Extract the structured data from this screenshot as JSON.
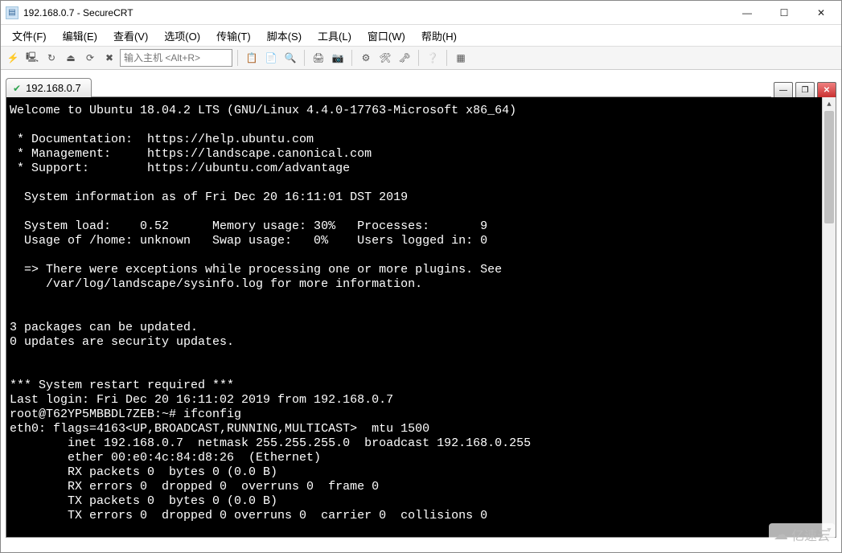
{
  "titlebar": {
    "title": "192.168.0.7 - SecureCRT"
  },
  "menubar": {
    "items": [
      "文件(F)",
      "编辑(E)",
      "查看(V)",
      "选项(O)",
      "传输(T)",
      "脚本(S)",
      "工具(L)",
      "窗口(W)",
      "帮助(H)"
    ]
  },
  "toolbar": {
    "host_placeholder": "输入主机 <Alt+R>"
  },
  "tab": {
    "label": "192.168.0.7"
  },
  "terminal": {
    "lines": [
      "Welcome to Ubuntu 18.04.2 LTS (GNU/Linux 4.4.0-17763-Microsoft x86_64)",
      "",
      " * Documentation:  https://help.ubuntu.com",
      " * Management:     https://landscape.canonical.com",
      " * Support:        https://ubuntu.com/advantage",
      "",
      "  System information as of Fri Dec 20 16:11:01 DST 2019",
      "",
      "  System load:    0.52      Memory usage: 30%   Processes:       9",
      "  Usage of /home: unknown   Swap usage:   0%    Users logged in: 0",
      "",
      "  => There were exceptions while processing one or more plugins. See",
      "     /var/log/landscape/sysinfo.log for more information.",
      "",
      "",
      "3 packages can be updated.",
      "0 updates are security updates.",
      "",
      "",
      "*** System restart required ***",
      "Last login: Fri Dec 20 16:11:02 2019 from 192.168.0.7",
      "root@T62YP5MBBDL7ZEB:~# ifconfig",
      "eth0: flags=4163<UP,BROADCAST,RUNNING,MULTICAST>  mtu 1500",
      "        inet 192.168.0.7  netmask 255.255.255.0  broadcast 192.168.0.255",
      "        ether 00:e0:4c:84:d8:26  (Ethernet)",
      "        RX packets 0  bytes 0 (0.0 B)",
      "        RX errors 0  dropped 0  overruns 0  frame 0",
      "        TX packets 0  bytes 0 (0.0 B)",
      "        TX errors 0  dropped 0 overruns 0  carrier 0  collisions 0"
    ]
  },
  "watermark": {
    "text": "亿速云"
  }
}
